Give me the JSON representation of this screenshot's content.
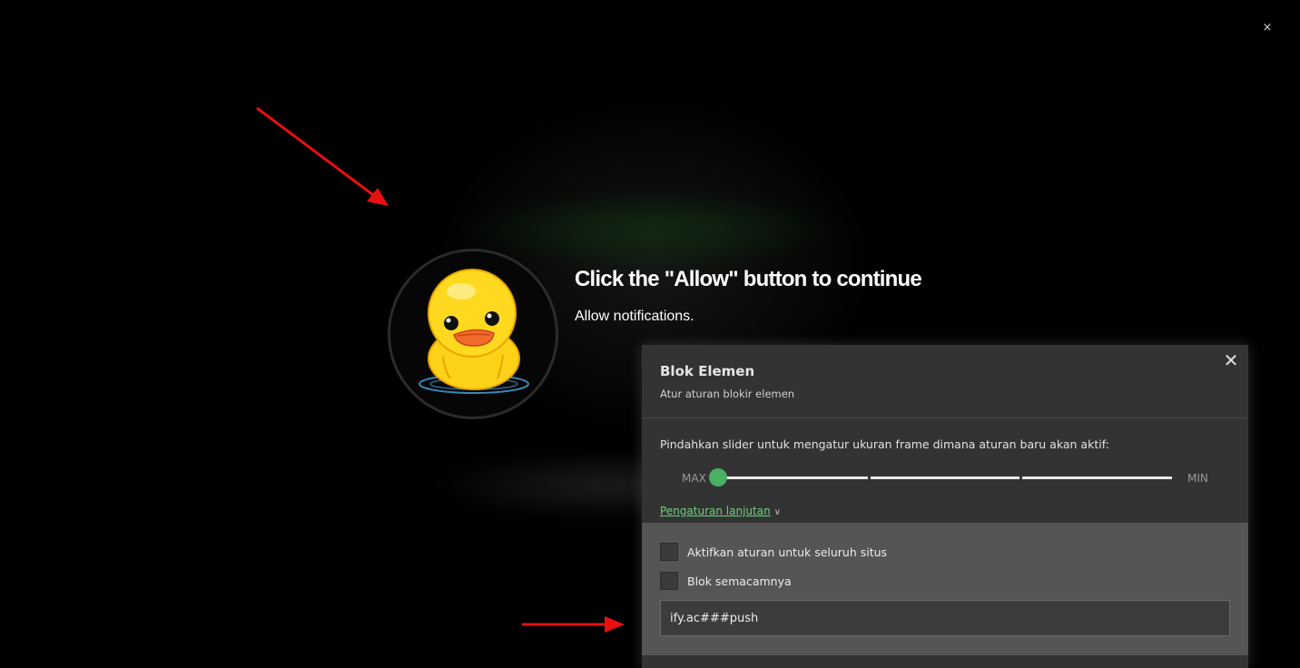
{
  "page": {
    "close_symbol": "×",
    "headline": "Click the \"Allow\" button to continue",
    "subline": "Allow notifications.",
    "avatar_icon": "duck-icon"
  },
  "annotations": {
    "arrow_color": "#e81010"
  },
  "panel": {
    "title": "Blok Elemen",
    "subtitle": "Atur aturan blokir elemen",
    "close_symbol": "✕",
    "slider": {
      "label": "Pindahkan slider untuk mengatur ukuran frame dimana aturan baru akan aktif:",
      "max_label": "MAX",
      "min_label": "MIN",
      "position": 0,
      "accent_color": "#4caf63"
    },
    "advanced_link": "Pengaturan lanjutan",
    "options": [
      {
        "label": "Aktifkan aturan untuk seluruh situs",
        "checked": false
      },
      {
        "label": "Blok semacamnya",
        "checked": false
      }
    ],
    "rule_value": "ify.ac###push"
  }
}
